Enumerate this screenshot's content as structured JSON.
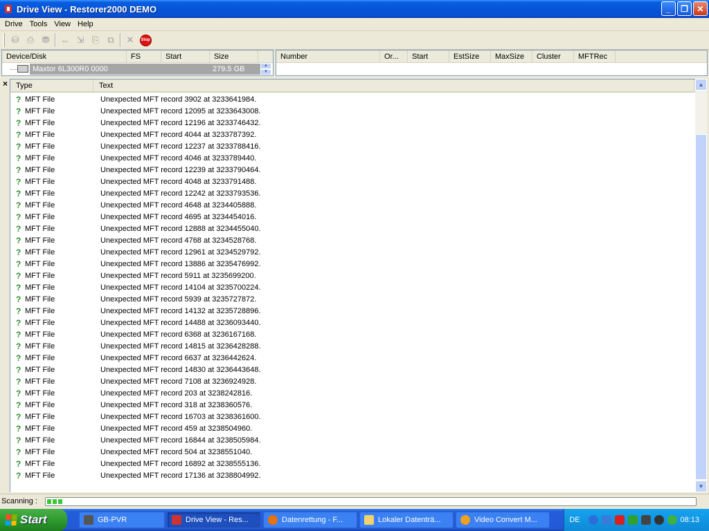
{
  "window": {
    "title": "Drive View - Restorer2000 DEMO"
  },
  "menu": [
    "Drive",
    "Tools",
    "View",
    "Help"
  ],
  "toolbar": {
    "stop_label": "Stop"
  },
  "device_pane": {
    "columns": [
      "Device/Disk",
      "FS",
      "Start",
      "Size"
    ],
    "device": {
      "name": "Maxtor 6L300R0 0000",
      "size": "279.5 GB"
    }
  },
  "partition_pane": {
    "columns": [
      "Number",
      "Or...",
      "Start",
      "EstSize",
      "MaxSize",
      "Cluster",
      "MFTRec"
    ]
  },
  "log": {
    "close": "×",
    "columns": [
      "Type",
      "Text"
    ],
    "rows": [
      {
        "type": "MFT File",
        "text": "Unexpected MFT record 3902 at 3233641984."
      },
      {
        "type": "MFT File",
        "text": "Unexpected MFT record 12095 at 3233643008."
      },
      {
        "type": "MFT File",
        "text": "Unexpected MFT record 12196 at 3233746432."
      },
      {
        "type": "MFT File",
        "text": "Unexpected MFT record 4044 at 3233787392."
      },
      {
        "type": "MFT File",
        "text": "Unexpected MFT record 12237 at 3233788416."
      },
      {
        "type": "MFT File",
        "text": "Unexpected MFT record 4046 at 3233789440."
      },
      {
        "type": "MFT File",
        "text": "Unexpected MFT record 12239 at 3233790464."
      },
      {
        "type": "MFT File",
        "text": "Unexpected MFT record 4048 at 3233791488."
      },
      {
        "type": "MFT File",
        "text": "Unexpected MFT record 12242 at 3233793536."
      },
      {
        "type": "MFT File",
        "text": "Unexpected MFT record 4648 at 3234405888."
      },
      {
        "type": "MFT File",
        "text": "Unexpected MFT record 4695 at 3234454016."
      },
      {
        "type": "MFT File",
        "text": "Unexpected MFT record 12888 at 3234455040."
      },
      {
        "type": "MFT File",
        "text": "Unexpected MFT record 4768 at 3234528768."
      },
      {
        "type": "MFT File",
        "text": "Unexpected MFT record 12961 at 3234529792."
      },
      {
        "type": "MFT File",
        "text": "Unexpected MFT record 13886 at 3235476992."
      },
      {
        "type": "MFT File",
        "text": "Unexpected MFT record 5911 at 3235699200."
      },
      {
        "type": "MFT File",
        "text": "Unexpected MFT record 14104 at 3235700224."
      },
      {
        "type": "MFT File",
        "text": "Unexpected MFT record 5939 at 3235727872."
      },
      {
        "type": "MFT File",
        "text": "Unexpected MFT record 14132 at 3235728896."
      },
      {
        "type": "MFT File",
        "text": "Unexpected MFT record 14488 at 3236093440."
      },
      {
        "type": "MFT File",
        "text": "Unexpected MFT record 6368 at 3236167168."
      },
      {
        "type": "MFT File",
        "text": "Unexpected MFT record 14815 at 3236428288."
      },
      {
        "type": "MFT File",
        "text": "Unexpected MFT record 6637 at 3236442624."
      },
      {
        "type": "MFT File",
        "text": "Unexpected MFT record 14830 at 3236443648."
      },
      {
        "type": "MFT File",
        "text": "Unexpected MFT record 7108 at 3236924928."
      },
      {
        "type": "MFT File",
        "text": "Unexpected MFT record 203 at 3238242816."
      },
      {
        "type": "MFT File",
        "text": "Unexpected MFT record 318 at 3238360576."
      },
      {
        "type": "MFT File",
        "text": "Unexpected MFT record 16703 at 3238361600."
      },
      {
        "type": "MFT File",
        "text": "Unexpected MFT record 459 at 3238504960."
      },
      {
        "type": "MFT File",
        "text": "Unexpected MFT record 16844 at 3238505984."
      },
      {
        "type": "MFT File",
        "text": "Unexpected MFT record 504 at 3238551040."
      },
      {
        "type": "MFT File",
        "text": "Unexpected MFT record 16892 at 3238555136."
      },
      {
        "type": "MFT File",
        "text": "Unexpected MFT record 17136 at 3238804992."
      }
    ]
  },
  "status": {
    "label": "Scanning :",
    "progress_segments": 3,
    "progress_fraction": 0.02
  },
  "taskbar": {
    "start": "Start",
    "tasks": [
      {
        "label": "GB-PVR",
        "icon": "tv-icon",
        "active": false
      },
      {
        "label": "Drive View - Res...",
        "icon": "restorer-icon",
        "active": true
      },
      {
        "label": "Datenrettung - F...",
        "icon": "firefox-icon",
        "active": false
      },
      {
        "label": "Lokaler Datenträ...",
        "icon": "folder-icon",
        "active": false
      },
      {
        "label": "Video Convert M...",
        "icon": "convert-icon",
        "active": false
      }
    ],
    "lang": "DE",
    "clock": "08:13"
  },
  "colors": {
    "title_bar": "#0554d8",
    "selection": "#a6a6a6",
    "progress": "#3ac83a",
    "taskbar": "#245edc",
    "start": "#2f9b2f"
  }
}
